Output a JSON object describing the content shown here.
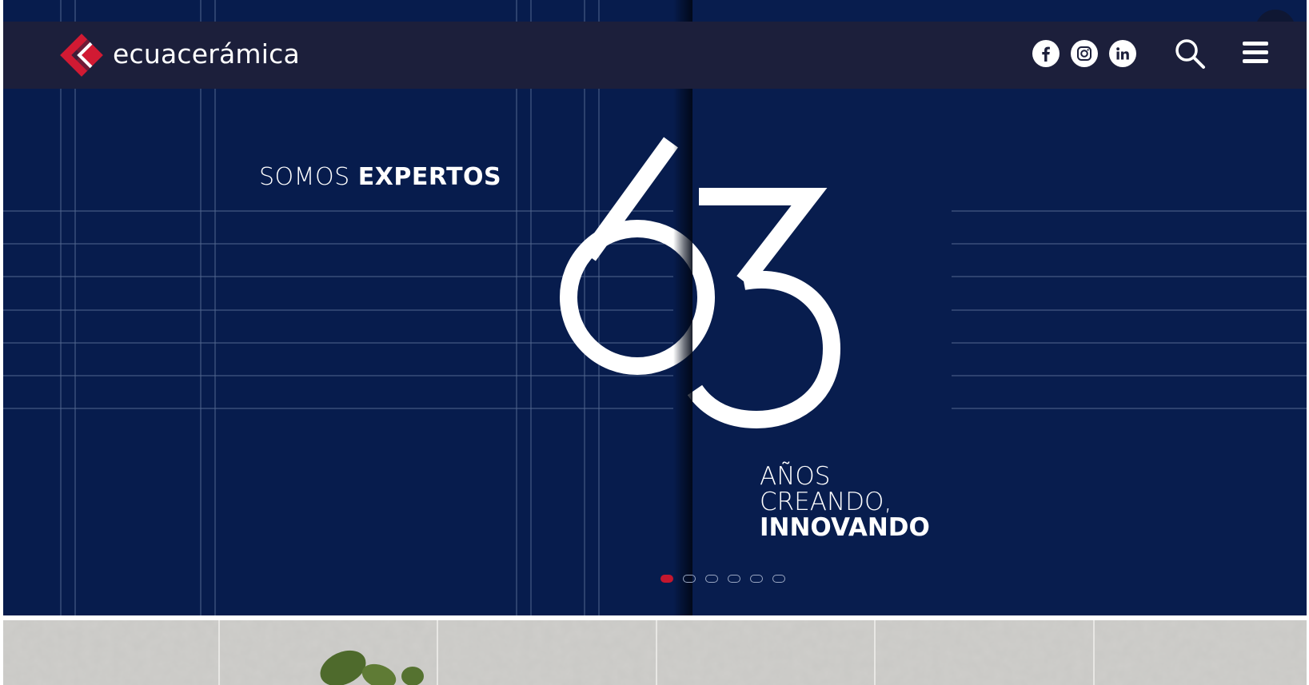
{
  "header": {
    "brand": "ecuacerámica",
    "social": [
      {
        "name": "facebook",
        "icon": "facebook-icon"
      },
      {
        "name": "instagram",
        "icon": "instagram-icon"
      },
      {
        "name": "linkedin",
        "icon": "linkedin-icon"
      }
    ],
    "search_icon": "search-icon",
    "menu_icon": "hamburger-menu-icon"
  },
  "hero": {
    "somos_light": "SOMOS ",
    "somos_bold": "EXPERTOS",
    "number": "63",
    "line1": "AÑOS",
    "line2": "CREANDO,",
    "line3": "INNOVANDO",
    "slides_total": 6,
    "slide_active": 1
  },
  "colors": {
    "hero_bg": "#071c4d",
    "header_bg": "#1c1f3b",
    "accent": "#c4172e",
    "text": "#ffffff"
  }
}
